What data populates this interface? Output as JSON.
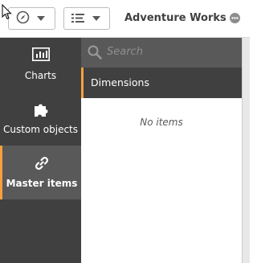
{
  "toolbar": {
    "nav_button": {
      "icon": "compass-icon"
    },
    "list_button": {
      "icon": "list-icon"
    },
    "app_title": "Adventure Works"
  },
  "sidebar": {
    "items": [
      {
        "label": "Charts",
        "icon": "bar-chart-icon",
        "active": false
      },
      {
        "label": "Custom objects",
        "icon": "puzzle-icon",
        "active": false
      },
      {
        "label": "Master items",
        "icon": "link-icon",
        "active": true
      }
    ]
  },
  "panel": {
    "search": {
      "placeholder": "Search",
      "value": ""
    },
    "section_title": "Dimensions",
    "empty_text": "No items"
  },
  "colors": {
    "accent": "#f8a03c",
    "sidebar_bg": "#404040",
    "active_bg": "#595959"
  }
}
